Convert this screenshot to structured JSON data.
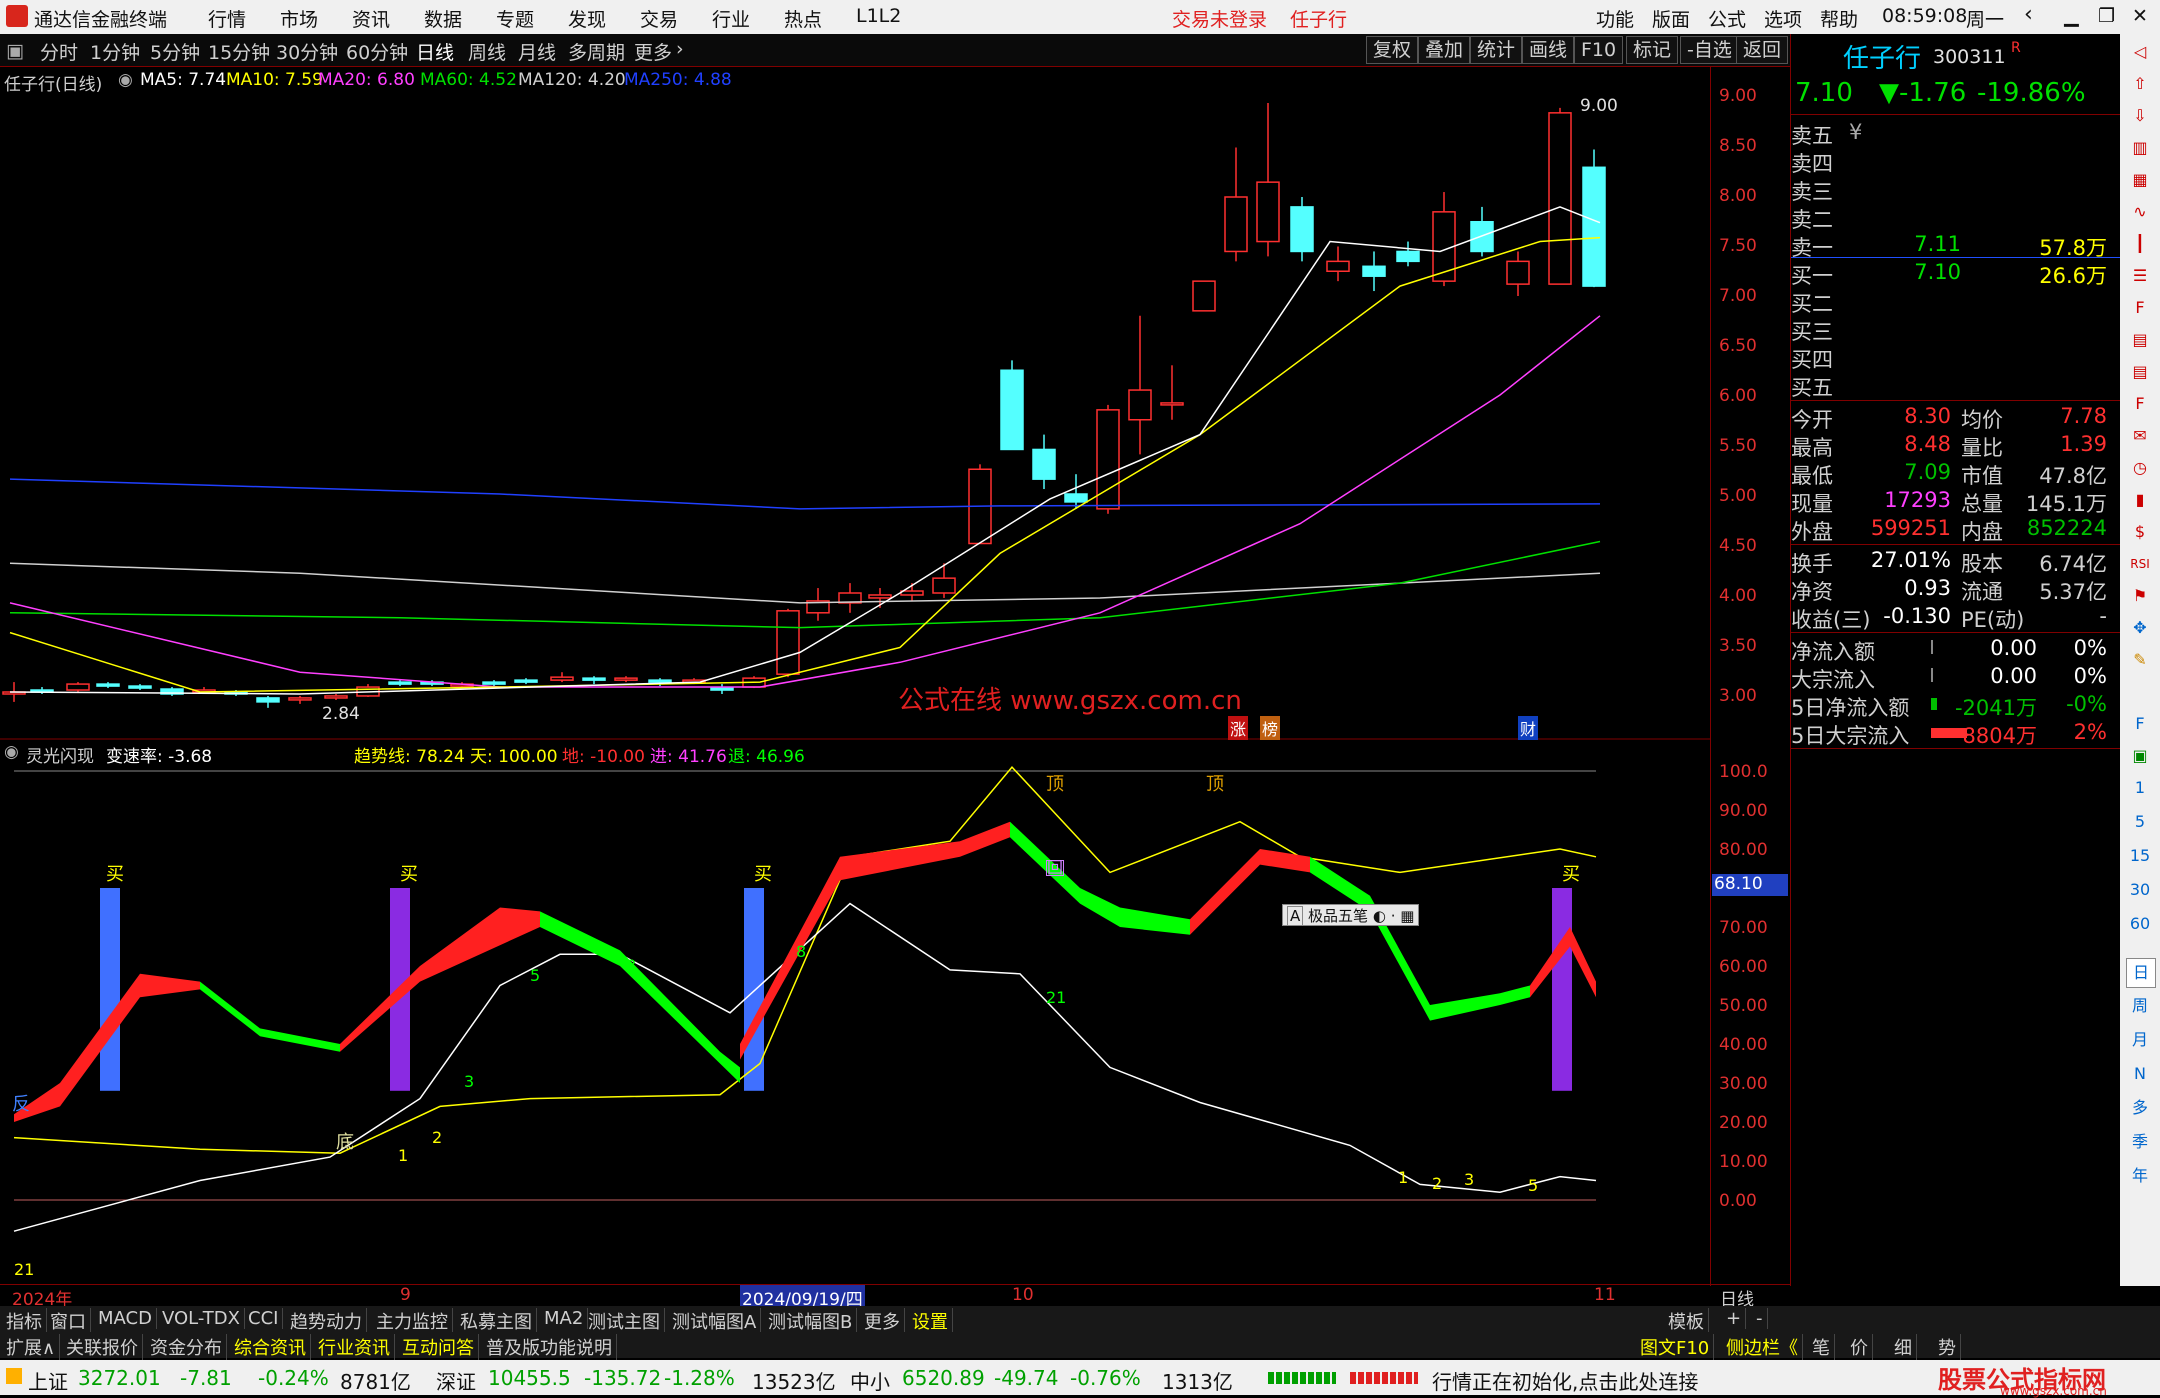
{
  "menu": {
    "app_title": "通达信金融终端",
    "items": [
      "行情",
      "市场",
      "资讯",
      "数据",
      "专题",
      "发现",
      "交易",
      "行业",
      "热点",
      "L1L2"
    ],
    "trade_status": "交易未登录",
    "stock_name": "任子行",
    "right_items": [
      "功能",
      "版面",
      "公式",
      "选项",
      "帮助"
    ],
    "time": "08:59:08",
    "weekday": "周一"
  },
  "periods": {
    "items": [
      "分时",
      "1分钟",
      "5分钟",
      "15分钟",
      "30分钟",
      "60分钟",
      "日线",
      "周线",
      "月线",
      "多周期",
      "更多"
    ],
    "active": "日线",
    "buttons": [
      "复权",
      "叠加",
      "统计",
      "画线",
      "F10",
      "标记",
      "-自选",
      "返回"
    ]
  },
  "main_chart": {
    "title": "任子行(日线)",
    "ma": [
      {
        "label": "MA5: 7.74",
        "color": "#ffffff"
      },
      {
        "label": "MA10: 7.59",
        "color": "#ffff00"
      },
      {
        "label": "MA20: 6.80",
        "color": "#ff40ff"
      },
      {
        "label": "MA60: 4.52",
        "color": "#00e000"
      },
      {
        "label": "MA120: 4.20",
        "color": "#d0d0d0"
      },
      {
        "label": "MA250: 4.88",
        "color": "#2040ff"
      }
    ],
    "max_label": "9.00",
    "min_label": "2.84",
    "watermark": "公式在线  www.gszx.com.cn",
    "markers": [
      "涨",
      "榜",
      "财"
    ],
    "y_ticks": [
      "9.00",
      "8.50",
      "8.00",
      "7.50",
      "7.00",
      "6.50",
      "6.00",
      "5.50",
      "5.00",
      "4.50",
      "4.00",
      "3.50",
      "3.00"
    ]
  },
  "sub_chart": {
    "title": "灵光闪现",
    "speed": "变速率: -3.68",
    "trend": "趋势线: 78.24",
    "sky": "天: 100.00",
    "ground": "地: -10.00",
    "enter": "进: 41.76",
    "exit": "退: 46.96",
    "buy_label": "买",
    "top_label": "顶",
    "bottom_label": "底",
    "reverse_label": "反",
    "return_label": "回",
    "current_value": "68.10",
    "y_ticks": [
      "100.0",
      "90.00",
      "80.00",
      "70.00",
      "60.00",
      "50.00",
      "40.00",
      "30.00",
      "20.00",
      "10.00",
      "0.00"
    ],
    "popup": "极品五笔",
    "counts": [
      "21",
      "1",
      "2",
      "3",
      "5",
      "8",
      "8",
      "21",
      "1",
      "2",
      "3",
      "5"
    ]
  },
  "date_bar": {
    "labels": [
      "2024年",
      "9",
      "2024/09/19/四",
      "10",
      "11"
    ],
    "period": "日线"
  },
  "quote": {
    "name": "任子行",
    "code": "300311",
    "price": "7.10",
    "change": "-1.76",
    "change_pct": "-19.86%",
    "asks": [
      {
        "label": "卖五",
        "price": "",
        "vol": ""
      },
      {
        "label": "卖四",
        "price": "",
        "vol": ""
      },
      {
        "label": "卖三",
        "price": "",
        "vol": ""
      },
      {
        "label": "卖二",
        "price": "",
        "vol": ""
      },
      {
        "label": "卖一",
        "price": "7.11",
        "vol": "57.8万"
      }
    ],
    "bids": [
      {
        "label": "买一",
        "price": "7.10",
        "vol": "26.6万"
      },
      {
        "label": "买二",
        "price": "",
        "vol": ""
      },
      {
        "label": "买三",
        "price": "",
        "vol": ""
      },
      {
        "label": "买四",
        "price": "",
        "vol": ""
      },
      {
        "label": "买五",
        "price": "",
        "vol": ""
      }
    ],
    "stats": [
      {
        "l1": "今开",
        "v1": "8.30",
        "c1": "#ff3030",
        "l2": "均价",
        "v2": "7.78",
        "c2": "#ff3030"
      },
      {
        "l1": "最高",
        "v1": "8.48",
        "c1": "#ff3030",
        "l2": "量比",
        "v2": "1.39",
        "c2": "#ff3030"
      },
      {
        "l1": "最低",
        "v1": "7.09",
        "c1": "#00c000",
        "l2": "市值",
        "v2": "47.8亿",
        "c2": "#d0d0d0"
      },
      {
        "l1": "现量",
        "v1": "17293",
        "c1": "#ff40ff",
        "l2": "总量",
        "v2": "145.1万",
        "c2": "#d0d0d0"
      },
      {
        "l1": "外盘",
        "v1": "599251",
        "c1": "#ff3030",
        "l2": "内盘",
        "v2": "852224",
        "c2": "#00c000"
      }
    ],
    "stats2": [
      {
        "l1": "换手",
        "v1": "27.01%",
        "c1": "#ffffff",
        "l2": "股本",
        "v2": "6.74亿",
        "c2": "#d0d0d0"
      },
      {
        "l1": "净资",
        "v1": "0.93",
        "c1": "#ffffff",
        "l2": "流通",
        "v2": "5.37亿",
        "c2": "#d0d0d0"
      },
      {
        "l1": "收益(三)",
        "v1": "-0.130",
        "c1": "#ffffff",
        "l2": "PE(动)",
        "v2": "-",
        "c2": "#d0d0d0"
      }
    ],
    "flows": [
      {
        "label": "净流入额",
        "value": "0.00",
        "pct": "0%",
        "vc": "#ffffff",
        "pc": "#ffffff"
      },
      {
        "label": "大宗流入",
        "value": "0.00",
        "pct": "0%",
        "vc": "#ffffff",
        "pc": "#ffffff"
      },
      {
        "label": "5日净流入额",
        "value": "-2041万",
        "pct": "-0%",
        "vc": "#00c000",
        "pc": "#00c000"
      },
      {
        "label": "5日大宗流入",
        "value": "8804万",
        "pct": "2%",
        "vc": "#ff3030",
        "pc": "#ff3030"
      }
    ]
  },
  "right_tools": [
    "1",
    "5",
    "15",
    "30",
    "60",
    "日",
    "周",
    "月",
    "N",
    "多",
    "季",
    "年"
  ],
  "tabs1": [
    "指标",
    "窗口",
    "MACD",
    "VOL-TDX",
    "CCI",
    "趋势动力",
    "主力监控",
    "私募主图",
    "MA2",
    "测试主图",
    "测试幅图A",
    "测试幅图B",
    "更多",
    "设置"
  ],
  "tabs1_right": [
    "模板"
  ],
  "tabs2": [
    "扩展∧",
    "关联报价",
    "资金分布",
    "综合资讯",
    "行业资讯",
    "互动问答",
    "普及版功能说明"
  ],
  "tabs2_right": [
    "图文F10",
    "侧边栏《",
    "笔",
    "价",
    "细",
    "势"
  ],
  "status": {
    "sh_name": "上证",
    "sh_val": "3272.01",
    "sh_chg": "-7.81",
    "sh_pct": "-0.24%",
    "sh_amt": "8781亿",
    "sz_name": "深证",
    "sz_val": "10455.5",
    "sz_chg": "-135.72",
    "sz_pct": "-1.28%",
    "sz_amt": "13523亿",
    "zx_name": "中小",
    "zx_val": "6520.89",
    "zx_chg": "-49.74",
    "zx_pct": "-0.76%",
    "zx_amt": "1313亿",
    "message": "行情正在初始化,点击此处连接",
    "brand": "股票公式指标网",
    "brand_url": "www.gszx.com.cn"
  }
}
